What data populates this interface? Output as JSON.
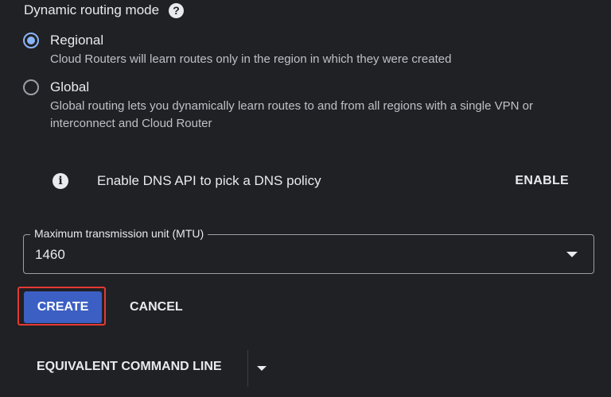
{
  "routing": {
    "title": "Dynamic routing mode",
    "help_icon": "?",
    "options": [
      {
        "label": "Regional",
        "description": "Cloud Routers will learn routes only in the region in which they were created",
        "checked": true
      },
      {
        "label": "Global",
        "description_line1": "Global routing lets you dynamically learn routes to and from all regions with a single VPN or",
        "description_line2": "interconnect and Cloud Router",
        "checked": false
      }
    ]
  },
  "dns_banner": {
    "icon": "info-icon",
    "glyph": "i",
    "text": "Enable DNS API to pick a DNS policy",
    "action_label": "ENABLE"
  },
  "mtu": {
    "label": "Maximum transmission unit (MTU)",
    "value": "1460"
  },
  "actions": {
    "create_label": "CREATE",
    "cancel_label": "CANCEL",
    "command_line_label": "EQUIVALENT COMMAND LINE"
  },
  "colors": {
    "background": "#202124",
    "accent": "#8ab4f8",
    "create_button": "#3c5fc3",
    "highlight": "#e53935"
  }
}
